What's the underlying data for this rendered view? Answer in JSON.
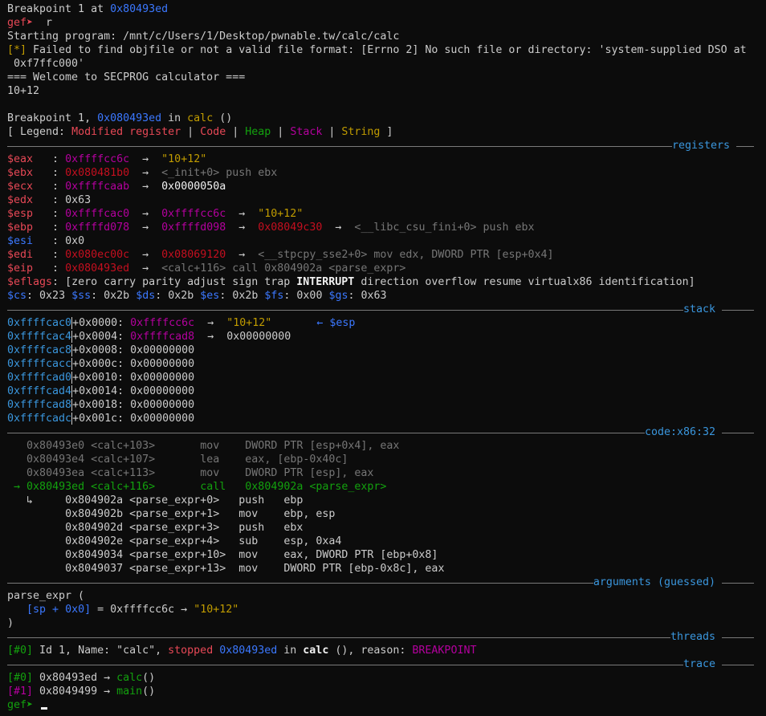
{
  "header": {
    "bp_set_prefix": "Breakpoint 1 at ",
    "bp_set_addr": "0x80493ed",
    "prompt": "gef➤ ",
    "run_cmd": " r",
    "starting": "Starting program: /mnt/c/Users/1/Desktop/pwnable.tw/calc/calc",
    "warn_tag": "[*]",
    "warn_text": " Failed to find objfile or not a valid file format: [Errno 2] No such file or directory: 'system-supplied DSO at",
    "warn_cont": " 0xf7ffc000'",
    "welcome": "=== Welcome to SECPROG calculator ===",
    "input": "10+12",
    "hit_prefix": "Breakpoint 1, ",
    "hit_addr": "0x080493ed",
    "hit_in": " in ",
    "hit_func": "calc",
    "hit_suffix": " ()"
  },
  "legend": {
    "open": "[ Legend: ",
    "modified": "Modified register",
    "sep": " | ",
    "code": "Code",
    "heap": "Heap",
    "stack": "Stack",
    "string": "String",
    "close": " ]"
  },
  "sections": {
    "registers": "registers",
    "stack": "stack",
    "code": "code:x86:32",
    "arguments": "arguments (guessed)",
    "threads": "threads",
    "trace": "trace"
  },
  "registers": [
    {
      "name": "$eax",
      "val": "0xffffcc6c",
      "arrow": "→",
      "deref": "\"10+12\""
    },
    {
      "name": "$ebx",
      "val": "0x080481b0",
      "arrow": "→",
      "deref": "<_init+0> push ebx"
    },
    {
      "name": "$ecx",
      "val": "0xffffcaab",
      "arrow": "→",
      "deref": "0x0000050a"
    },
    {
      "name": "$edx",
      "val": "0x63"
    },
    {
      "name": "$esp",
      "val": "0xffffcac0",
      "arrow": "→",
      "deref": "0xffffcc6c",
      "arrow2": "→",
      "deref2": "\"10+12\""
    },
    {
      "name": "$ebp",
      "val": "0xffffd078",
      "arrow": "→",
      "deref": "0xffffd098",
      "arrow2": "→",
      "deref2": "0x08049c30",
      "arrow3": "→",
      "deref3": "<__libc_csu_fini+0> push ebx"
    },
    {
      "name": "$esi",
      "val": "0x0"
    },
    {
      "name": "$edi",
      "val": "0x080ec00c",
      "arrow": "→",
      "deref": "0x08069120",
      "arrow2": "→",
      "deref2": "<__stpcpy_sse2+0> mov edx, DWORD PTR [esp+0x4]"
    },
    {
      "name": "$eip",
      "val": "0x080493ed",
      "arrow": "→",
      "deref": "<calc+116> call 0x804902a <parse_expr>"
    }
  ],
  "eflags": {
    "name": "$eflags",
    "value": "[zero carry parity adjust sign trap ",
    "interrupt": "INTERRUPT",
    "rest": " direction overflow resume virtualx86 identification]"
  },
  "segs": [
    {
      "name": "$cs",
      "val": "0x23"
    },
    {
      "name": "$ss",
      "val": "0x2b"
    },
    {
      "name": "$ds",
      "val": "0x2b"
    },
    {
      "name": "$es",
      "val": "0x2b"
    },
    {
      "name": "$fs",
      "val": "0x00"
    },
    {
      "name": "$gs",
      "val": "0x63"
    }
  ],
  "stack": [
    {
      "addr": "0xffffcac0",
      "off": "+0x0000: ",
      "val": "0xffffcc6c",
      "arrow": "→",
      "deref": "\"10+12\"",
      "note": "← $esp"
    },
    {
      "addr": "0xffffcac4",
      "off": "+0x0004: ",
      "val": "0xffffcad8",
      "arrow": "→",
      "deref": "0x00000000"
    },
    {
      "addr": "0xffffcac8",
      "off": "+0x0008: ",
      "val": "0x00000000"
    },
    {
      "addr": "0xffffcacc",
      "off": "+0x000c: ",
      "val": "0x00000000"
    },
    {
      "addr": "0xffffcad0",
      "off": "+0x0010: ",
      "val": "0x00000000"
    },
    {
      "addr": "0xffffcad4",
      "off": "+0x0014: ",
      "val": "0x00000000"
    },
    {
      "addr": "0xffffcad8",
      "off": "+0x0018: ",
      "val": "0x00000000"
    },
    {
      "addr": "0xffffcadc",
      "off": "+0x001c: ",
      "val": "0x00000000"
    }
  ],
  "code": [
    {
      "addr": "0x80493e0",
      "sym": "<calc+103>",
      "op": "mov",
      "args": "DWORD PTR [esp+0x4], eax",
      "state": "past"
    },
    {
      "addr": "0x80493e4",
      "sym": "<calc+107>",
      "op": "lea",
      "args": "eax, [ebp-0x40c]",
      "state": "past"
    },
    {
      "addr": "0x80493ea",
      "sym": "<calc+113>",
      "op": "mov",
      "args": "DWORD PTR [esp], eax",
      "state": "past"
    },
    {
      "addr": "0x80493ed",
      "sym": "<calc+116>",
      "op": "call",
      "args": "0x804902a <parse_expr>",
      "state": "current",
      "marker": "→"
    }
  ],
  "code_sub": {
    "marker": "↳"
  },
  "code_inner": [
    {
      "addr": "0x804902a",
      "sym": "<parse_expr+0>",
      "op": "push",
      "args": "ebp"
    },
    {
      "addr": "0x804902b",
      "sym": "<parse_expr+1>",
      "op": "mov",
      "args": "ebp, esp"
    },
    {
      "addr": "0x804902d",
      "sym": "<parse_expr+3>",
      "op": "push",
      "args": "ebx"
    },
    {
      "addr": "0x804902e",
      "sym": "<parse_expr+4>",
      "op": "sub",
      "args": "esp, 0xa4"
    },
    {
      "addr": "0x8049034",
      "sym": "<parse_expr+10>",
      "op": "mov",
      "args": "eax, DWORD PTR [ebp+0x8]"
    },
    {
      "addr": "0x8049037",
      "sym": "<parse_expr+13>",
      "op": "mov",
      "args": "DWORD PTR [ebp-0x8c], eax"
    }
  ],
  "arguments": {
    "open": "parse_expr (",
    "arg_name": "[sp + 0x0]",
    "arg_eq": " = 0xffffcc6c → ",
    "arg_val": "\"10+12\"",
    "close": ")"
  },
  "threads": {
    "idx": "[#0]",
    "text1": " Id 1, Name: \"calc\", ",
    "stopped": "stopped",
    "addr": " 0x80493ed",
    "in": " in ",
    "func": "calc",
    "text2": " (), reason: ",
    "reason": "BREAKPOINT"
  },
  "trace": [
    {
      "idx": "[#0]",
      "addr": " 0x80493ed → ",
      "func": "calc",
      "args": "()"
    },
    {
      "idx": "[#1]",
      "addr": " 0x8049499 → ",
      "func": "main",
      "args": "()"
    }
  ],
  "footer": {
    "prompt": "gef➤ "
  }
}
